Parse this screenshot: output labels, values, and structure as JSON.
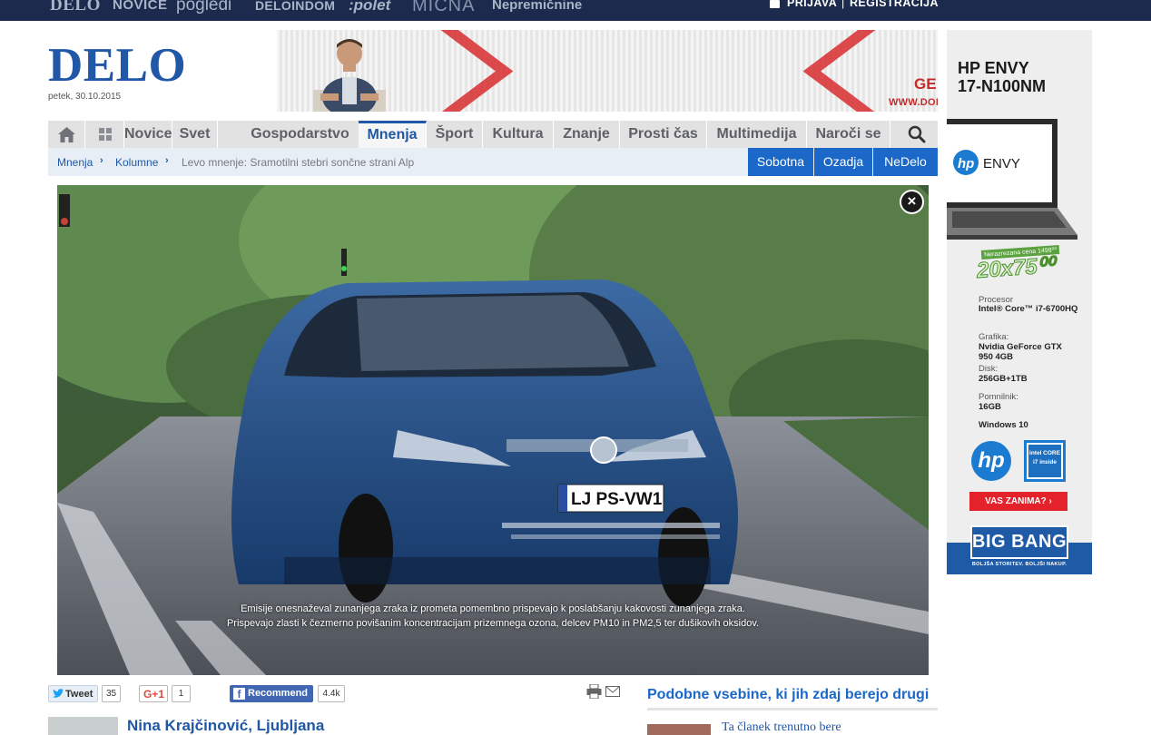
{
  "topbar": {
    "brands": [
      "DELO",
      "NOVICE",
      "pogledi",
      "DELOINDOM",
      ":polet",
      "MIČNA",
      "Nepremičnine"
    ],
    "login": "PRIJAVA",
    "separator": "|",
    "register": "REGISTRACIJA"
  },
  "header": {
    "logo": "DELO",
    "date": "petek, 30.10.2015"
  },
  "top_banner": {
    "ge_text": "GE",
    "url_text": "WWW.DOBI"
  },
  "nav": {
    "items": [
      "Novice",
      "Svet",
      "Gospodarstvo",
      "Mnenja",
      "Šport",
      "Kultura",
      "Znanje",
      "Prosti čas",
      "Multimedija",
      "Naroči se"
    ],
    "active": "Mnenja"
  },
  "breadcrumb": {
    "items": [
      "Mnenja",
      "Kolumne",
      "Levo mnenje: Sramotilni stebri sončne strani Alp"
    ]
  },
  "subtabs": [
    "Sobotna",
    "Ozadja",
    "NeDelo"
  ],
  "video": {
    "plate": "LJ PS-VW1",
    "caption_line1": "Emisije onesnaževal zunanjega zraka iz prometa pomembno prispevajo k poslabšanju kakovosti zunanjega zraka.",
    "caption_line2": "Prispevajo zlasti k čezmerno povišanim koncentracijam prizemnega ozona, delcev PM10 in PM2,5 ter dušikovih oksidov.",
    "close_symbol": "×"
  },
  "share": {
    "tweet_label": "Tweet",
    "tweet_count": "35",
    "gplus_label": "G+1",
    "gplus_count": "1",
    "fb_label": "Recommend",
    "fb_count": "4.4k"
  },
  "related": {
    "title": "Podobne vsebine, ki jih zdaj berejo drugi",
    "first_item": "Ta članek trenutno bere"
  },
  "article": {
    "author": "Nina Krajčinović, Ljubljana"
  },
  "side_ad": {
    "title_line1": "HP ENVY",
    "title_line2": "17-N100NM",
    "screen_brand": "ENVY",
    "price_label": "Nerazrezana cena 1499⁰⁰",
    "price": "20x75⁰⁰",
    "specs": [
      {
        "key": "Procesor",
        "value": "Intel® Core™ i7-6700HQ"
      },
      {
        "key": "Grafika:",
        "value": "Nvidia GeForce GTX 950 4GB"
      },
      {
        "key": "Disk:",
        "value": "256GB+1TB"
      },
      {
        "key": "Pomnilnik:",
        "value": "16GB"
      }
    ],
    "os": "Windows 10",
    "hp_logo": "hp",
    "intel_text": "intel CORE i7 inside",
    "cta": "VAS ZANIMA? ›",
    "store": "BIG BANG",
    "store_tagline": "BOLJŠA STORITEV. BOLJŠI NAKUP."
  },
  "colors": {
    "topbar_bg": "#1c2b4d",
    "brand_blue": "#2057a6",
    "tab_blue": "#1b68c8",
    "nav_bg": "#e2e2e2"
  }
}
